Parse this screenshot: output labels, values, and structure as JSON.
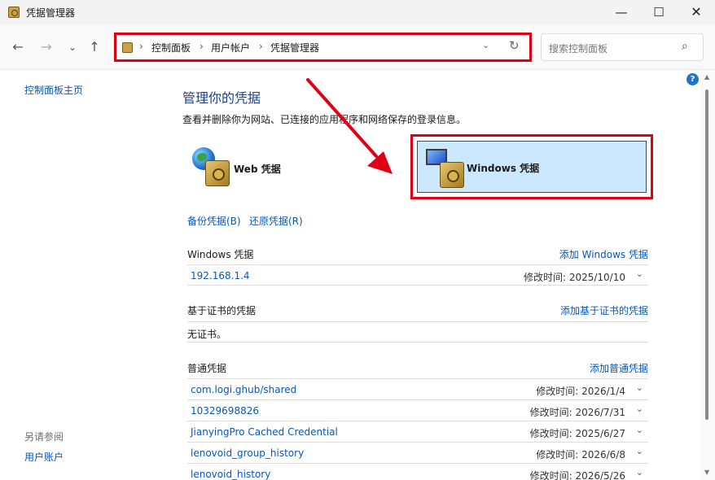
{
  "window": {
    "title": "凭据管理器",
    "minimize": "—",
    "maximize": "☐",
    "close": "✕"
  },
  "nav": {
    "back": "←",
    "forward": "→",
    "recent": "⌄",
    "up": "↑"
  },
  "address": {
    "crumbs": [
      "控制面板",
      "用户帐户",
      "凭据管理器"
    ],
    "separator": "›",
    "dropdown": "⌄",
    "refresh": "↻"
  },
  "search": {
    "placeholder": "搜索控制面板",
    "icon": "⌕"
  },
  "sidebar": {
    "home": "控制面板主页",
    "see_also": "另请参阅",
    "user_accounts": "用户账户"
  },
  "help": "?",
  "main": {
    "title": "管理你的凭据",
    "description": "查看并删除你为网站、已连接的应用程序和网络保存的登录信息。",
    "web_tile": "Web 凭据",
    "windows_tile": "Windows 凭据",
    "backup": "备份凭据(B)",
    "restore": "还原凭据(R)"
  },
  "sections": {
    "windows": {
      "title": "Windows 凭据",
      "add": "添加 Windows 凭据",
      "items": [
        {
          "name": "192.168.1.4",
          "modified": "修改时间:  2025/10/10"
        }
      ]
    },
    "certificate": {
      "title": "基于证书的凭据",
      "add": "添加基于证书的凭据",
      "empty": "无证书。"
    },
    "generic": {
      "title": "普通凭据",
      "add": "添加普通凭据",
      "items": [
        {
          "name": "com.logi.ghub/shared",
          "modified": "修改时间:  2026/1/4"
        },
        {
          "name": "10329698826",
          "modified": "修改时间:  2026/7/31"
        },
        {
          "name": "JianyingPro Cached Credential",
          "modified": "修改时间:  2025/6/27"
        },
        {
          "name": "lenovoid_group_history",
          "modified": "修改时间:  2026/6/8"
        },
        {
          "name": "lenovoid_history",
          "modified": "修改时间:  2026/5/26"
        }
      ]
    }
  },
  "icons": {
    "app": "credential-manager-icon",
    "web": "globe-vault-icon",
    "windows": "monitor-vault-icon",
    "chevron": "⌄"
  },
  "colors": {
    "accent_link": "#0a56b4",
    "highlight_red": "#e00016",
    "tile_selected": "#cce8ff",
    "heading_blue": "#1e3f8a"
  }
}
